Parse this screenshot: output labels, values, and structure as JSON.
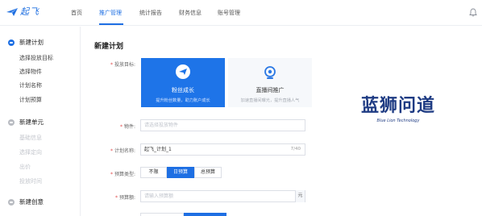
{
  "app": {
    "logo_text": "起飞"
  },
  "nav": {
    "items": [
      "首页",
      "推广管理",
      "统计报告",
      "财务信息",
      "账号管理"
    ],
    "active_index": 1
  },
  "sidebar": {
    "groups": [
      {
        "title": "新建计划",
        "active": true,
        "items": [
          {
            "label": "选择投放目标",
            "muted": false
          },
          {
            "label": "选择物件",
            "muted": false
          },
          {
            "label": "计划名称",
            "muted": false
          },
          {
            "label": "计划预算",
            "muted": false
          }
        ]
      },
      {
        "title": "新建单元",
        "active": false,
        "items": [
          {
            "label": "基础信息",
            "muted": true
          },
          {
            "label": "选择定向",
            "muted": true
          },
          {
            "label": "出价",
            "muted": true
          },
          {
            "label": "投放时间",
            "muted": true
          }
        ]
      },
      {
        "title": "新建创意",
        "active": false,
        "items": []
      }
    ]
  },
  "panel": {
    "title": "新建计划",
    "labels": {
      "goal": "投放目标:",
      "item": "物件:",
      "plan_name": "计划名称:",
      "budget_type": "预算类型:",
      "budget": "预算额:"
    },
    "goals": [
      {
        "name": "粉丝成长",
        "desc": "提升粉丝数量，助力账户成长",
        "icon": "paper-plane-icon",
        "selected": true
      },
      {
        "name": "直播间推广",
        "desc": "加速直播间曝光，提升直播人气",
        "icon": "live-camera-icon",
        "selected": false
      }
    ],
    "item_placeholder": "请选择投放物件",
    "plan_name_value": "起飞_计划_1",
    "plan_name_counter": "7/40",
    "budget_types": [
      "不限",
      "日预算",
      "总预算"
    ],
    "budget_type_selected": 1,
    "budget_placeholder": "请输入预算额",
    "budget_unit": "元"
  },
  "brand": {
    "name": "蓝狮问道",
    "subtitle": "Blue Lion Technology"
  },
  "colors": {
    "accent": "#1e6fe3",
    "brand": "#1e3b83"
  }
}
